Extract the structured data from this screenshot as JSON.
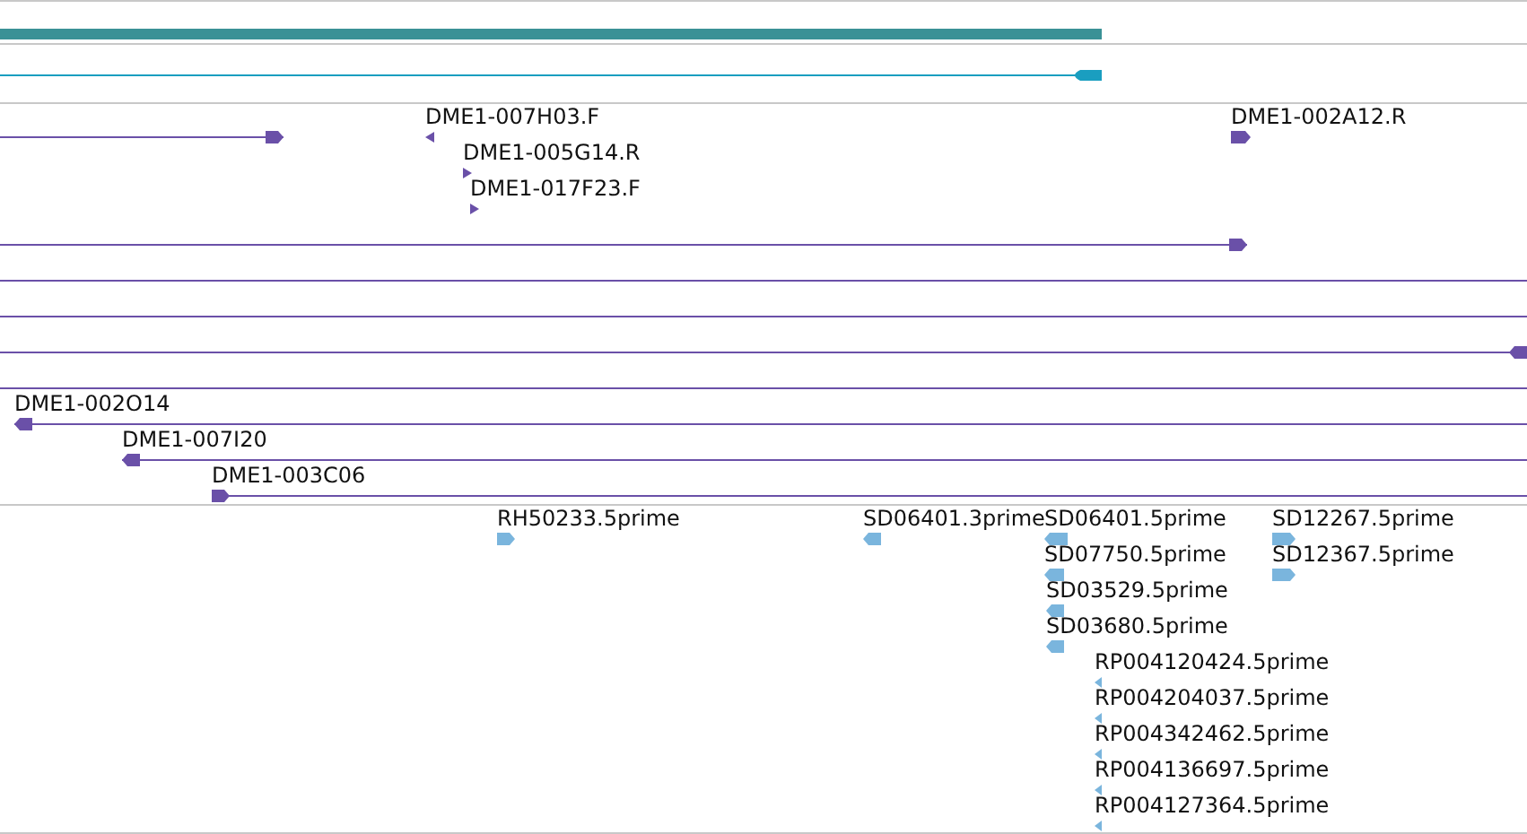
{
  "tracks": [
    {
      "kind": "coverage",
      "color": "#3a9196"
    },
    {
      "kind": "transcript",
      "color": "#1a9ec0",
      "reverse": true
    },
    {
      "kind": "features",
      "color": "#6a50a8",
      "features": [
        {
          "arrowhead": true,
          "reverse": false
        },
        {
          "label": "DME1-007H03.F",
          "arrowhead": true,
          "reverse": true
        },
        {
          "label": "DME1-002A12.R",
          "arrowhead": true,
          "reverse": false
        },
        {
          "label": "DME1-005G14.R",
          "arrowhead": true,
          "reverse": false
        },
        {
          "label": "DME1-017F23.F",
          "arrowhead": true,
          "reverse": false
        },
        {
          "arrowhead": true,
          "reverse": false
        },
        {
          "arrowhead": false
        },
        {
          "arrowhead": false
        },
        {
          "arrowhead": true,
          "reverse": true
        },
        {
          "arrowhead": false
        },
        {
          "label": "DME1-002O14",
          "arrowhead": true,
          "reverse": true
        },
        {
          "label": "DME1-007I20",
          "arrowhead": true,
          "reverse": true
        },
        {
          "label": "DME1-003C06",
          "arrowhead": true,
          "reverse": false
        }
      ]
    },
    {
      "kind": "features",
      "color": "#7ab5dd",
      "features": [
        {
          "label": "RH50233.5prime",
          "arrowhead": true,
          "reverse": false
        },
        {
          "label": "SD06401.3prime",
          "arrowhead": true,
          "reverse": true
        },
        {
          "label": "SD06401.5prime",
          "arrowhead": true,
          "reverse": true
        },
        {
          "label": "SD12267.5prime",
          "arrowhead": true,
          "reverse": false
        },
        {
          "label": "SD07750.5prime",
          "arrowhead": true,
          "reverse": true
        },
        {
          "label": "SD12367.5prime",
          "arrowhead": true,
          "reverse": false
        },
        {
          "label": "SD03529.5prime",
          "arrowhead": true,
          "reverse": true
        },
        {
          "label": "SD03680.5prime",
          "arrowhead": true,
          "reverse": true
        },
        {
          "label": "RP004120424.5prime",
          "arrowhead": true,
          "reverse": true
        },
        {
          "label": "RP004204037.5prime",
          "arrowhead": true,
          "reverse": true
        },
        {
          "label": "RP004342462.5prime",
          "arrowhead": true,
          "reverse": true
        },
        {
          "label": "RP004136697.5prime",
          "arrowhead": true,
          "reverse": true
        },
        {
          "label": "RP004127364.5prime",
          "arrowhead": true,
          "reverse": true
        }
      ]
    }
  ]
}
